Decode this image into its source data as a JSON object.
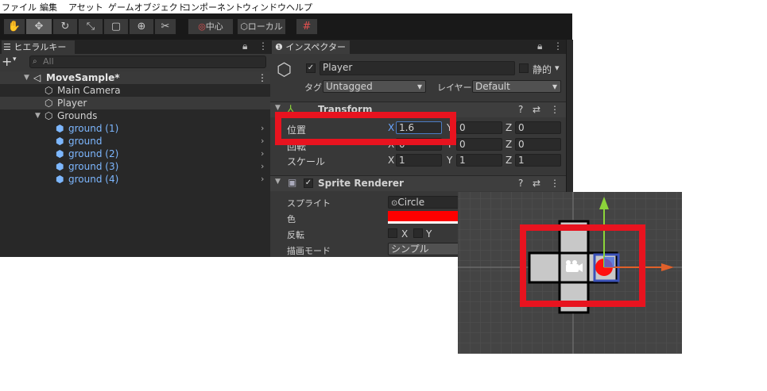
{
  "menu": [
    "ファイル",
    "編集",
    "アセット",
    "ゲームオブジェクト",
    "コンポーネント",
    "ウィンドウ",
    "ヘルプ"
  ],
  "toolbar": {
    "pivot_label": "中心",
    "space_label": "ローカル"
  },
  "hierarchy": {
    "tab_label": "ヒエラルキー",
    "search_placeholder": "All",
    "scene_name": "MoveSample*",
    "items": [
      "Main Camera",
      "Player",
      "Grounds"
    ],
    "grounds_children": [
      "ground (1)",
      "ground",
      "ground (2)",
      "ground (3)",
      "ground (4)"
    ]
  },
  "inspector": {
    "tab_label": "インスペクター",
    "object_name": "Player",
    "static_label": "静的",
    "tag_label": "タグ",
    "tag_value": "Untagged",
    "layer_label": "レイヤー",
    "layer_value": "Default",
    "transform": {
      "title": "Transform",
      "position_label": "位置",
      "rotation_label": "回転",
      "scale_label": "スケール",
      "axis_x": "X",
      "axis_y": "Y",
      "axis_z": "Z",
      "position": {
        "x": "1.6",
        "y": "0",
        "z": "0"
      },
      "rotation": {
        "x": "0",
        "y": "0",
        "z": "0"
      },
      "scale": {
        "x": "1",
        "y": "1",
        "z": "1"
      }
    },
    "sprite_renderer": {
      "title": "Sprite Renderer",
      "sprite_label": "スプライト",
      "sprite_value": "Circle",
      "color_label": "色",
      "color_value": "#ff0000",
      "flip_label": "反転",
      "flip_x": "X",
      "flip_y": "Y",
      "draw_mode_label": "描画モード",
      "draw_mode_value": "シンプル"
    }
  },
  "colors": {
    "highlight": "#e8131f",
    "selection_blue": "#7db7ff",
    "x_axis": "#e0602a",
    "y_axis": "#8cd43a"
  }
}
